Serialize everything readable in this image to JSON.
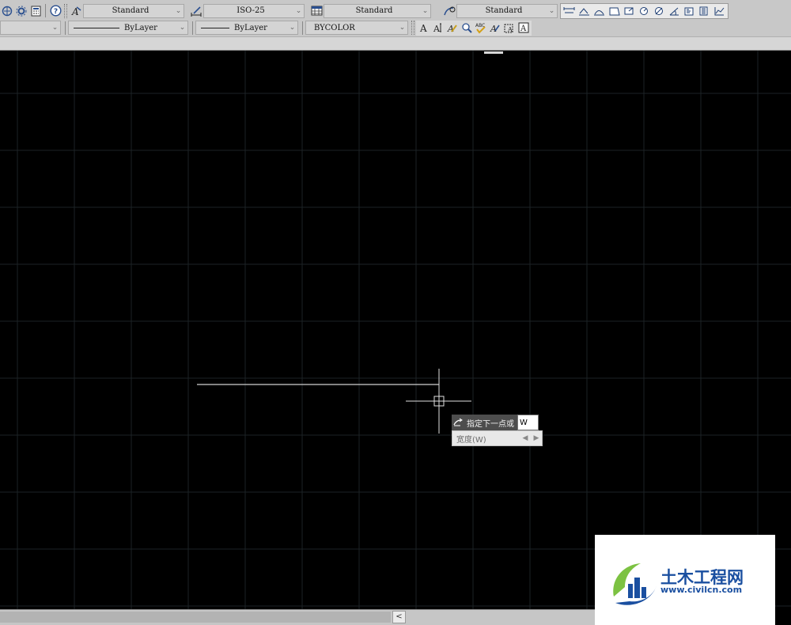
{
  "toolbar": {
    "text_style": "Standard",
    "dim_style": "ISO-25",
    "table_style": "Standard",
    "multileader_style": "Standard",
    "color": "",
    "linetype": "ByLayer",
    "lineweight": "ByLayer",
    "plot_style": "BYCOLOR"
  },
  "dynamic_input": {
    "prompt": "指定下一点或",
    "value": "W",
    "option": "宽度(W)"
  },
  "watermark": {
    "name": "土木工程网",
    "url": "www.civilcn.com"
  },
  "colors": {
    "canvas_bg": "#000000",
    "grid_line": "#1c2226",
    "drawn_line": "#cfcfcf",
    "crosshair": "#e0e0e0",
    "brand_blue": "#1a4fa0",
    "brand_green": "#7cc242"
  }
}
